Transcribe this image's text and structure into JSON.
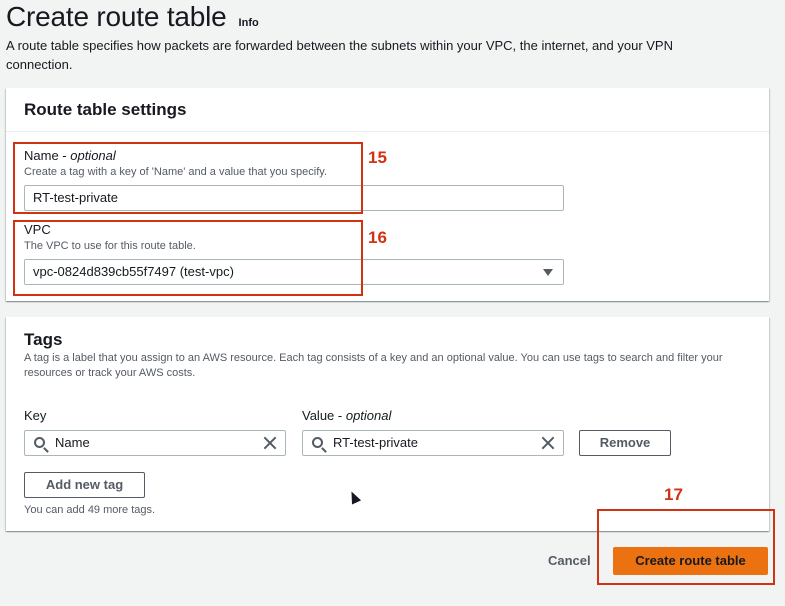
{
  "header": {
    "title": "Create route table",
    "info_label": "Info",
    "description": "A route table specifies how packets are forwarded between the subnets within your VPC, the internet, and your VPN connection."
  },
  "settings": {
    "title": "Route table settings",
    "name": {
      "label": "Name - ",
      "optional": "optional",
      "description": "Create a tag with a key of 'Name' and a value that you specify.",
      "value": "RT-test-private"
    },
    "vpc": {
      "label": "VPC",
      "description": "The VPC to use for this route table.",
      "value": "vpc-0824d839cb55f7497 (test-vpc)"
    }
  },
  "tags": {
    "title": "Tags",
    "description": "A tag is a label that you assign to an AWS resource. Each tag consists of a key and an optional value. You can use tags to search and filter your resources or track your AWS costs.",
    "key_label": "Key",
    "value_label": "Value - ",
    "value_optional": "optional",
    "rows": [
      {
        "key": "Name",
        "value": "RT-test-private"
      }
    ],
    "remove_label": "Remove",
    "add_label": "Add new tag",
    "hint": "You can add 49 more tags."
  },
  "footer": {
    "cancel_label": "Cancel",
    "submit_label": "Create route table"
  },
  "annotations": {
    "name_step": "15",
    "vpc_step": "16",
    "submit_step": "17",
    "color": "#d13212"
  },
  "colors": {
    "primary": "#ec7211",
    "background": "#f2f3f3"
  }
}
